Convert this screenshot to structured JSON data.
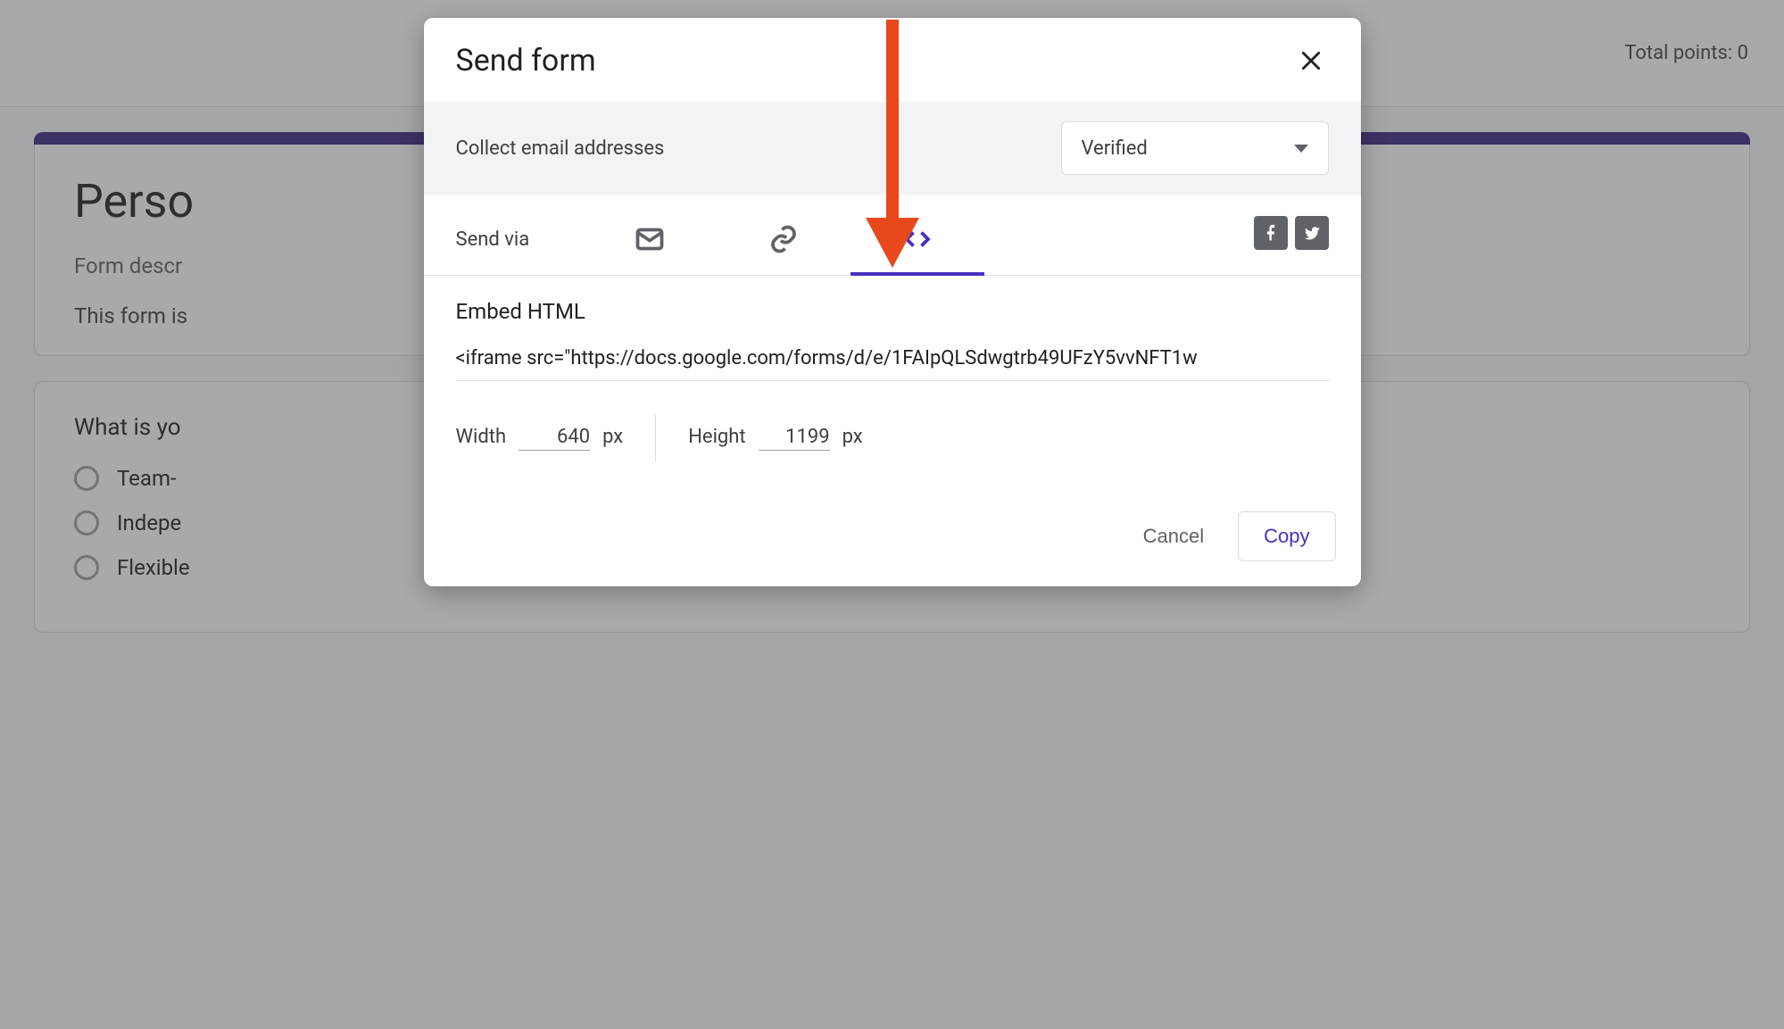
{
  "background": {
    "total_points_label": "Total points: 0",
    "form_title": "Perso",
    "form_description_label": "Form descr",
    "form_note": "This form is",
    "question": "What is yo",
    "options": [
      "Team-",
      "Indepe",
      "Flexible"
    ]
  },
  "modal": {
    "title": "Send form",
    "collect_label": "Collect email addresses",
    "collect_value": "Verified",
    "send_via_label": "Send via",
    "panel_title": "Embed HTML",
    "iframe_code": "<iframe src=\"https://docs.google.com/forms/d/e/1FAIpQLSdwgtrb49UFzY5vvNFT1w",
    "width_label": "Width",
    "width_value": "640",
    "height_label": "Height",
    "height_value": "1199",
    "px_label": "px",
    "cancel_label": "Cancel",
    "copy_label": "Copy"
  }
}
